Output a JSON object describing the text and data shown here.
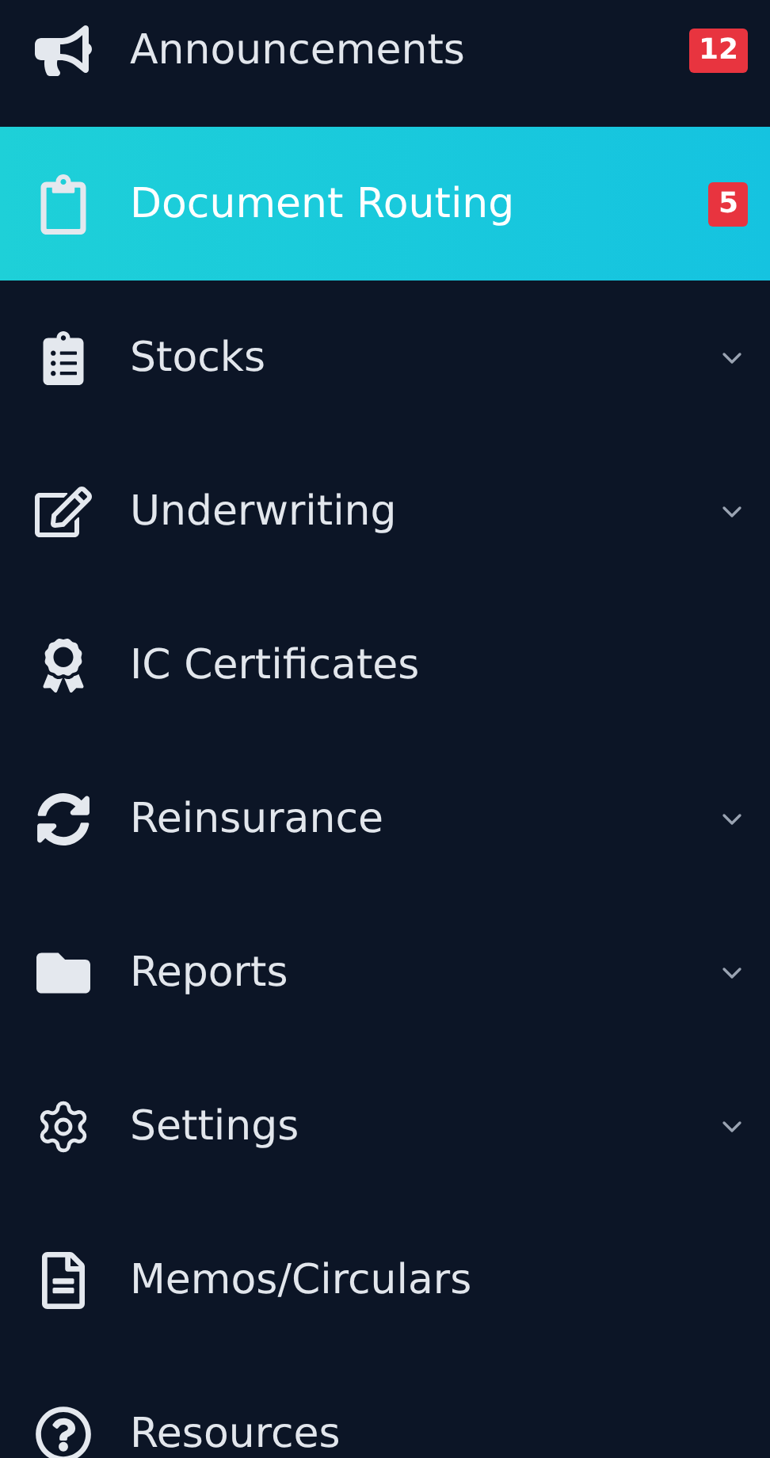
{
  "sidebar": {
    "items": [
      {
        "label": "Announcements",
        "badge": "12",
        "selected": false,
        "expandable": false
      },
      {
        "label": "Document Routing",
        "badge": "5",
        "selected": true,
        "expandable": false
      },
      {
        "label": "Stocks",
        "selected": false,
        "expandable": true
      },
      {
        "label": "Underwriting",
        "selected": false,
        "expandable": true
      },
      {
        "label": "IC Certificates",
        "selected": false,
        "expandable": false
      },
      {
        "label": "Reinsurance",
        "selected": false,
        "expandable": true
      },
      {
        "label": "Reports",
        "selected": false,
        "expandable": true
      },
      {
        "label": "Settings",
        "selected": false,
        "expandable": true
      },
      {
        "label": "Memos/Circulars",
        "selected": false,
        "expandable": false
      },
      {
        "label": "Resources",
        "selected": false,
        "expandable": false
      }
    ]
  }
}
